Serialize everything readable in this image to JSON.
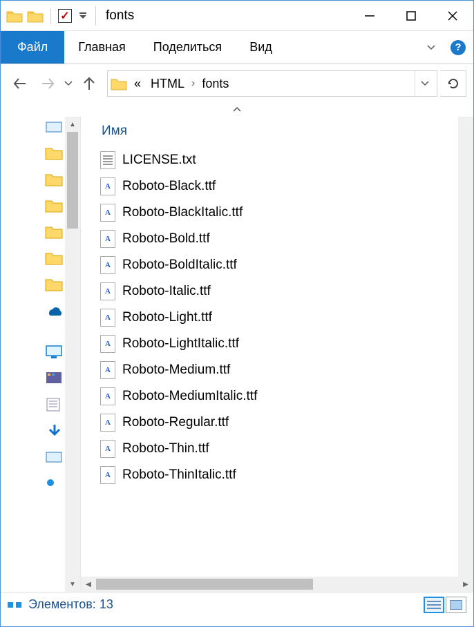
{
  "window": {
    "title": "fonts"
  },
  "ribbon": {
    "file": "Файл",
    "tabs": [
      "Главная",
      "Поделиться",
      "Вид"
    ]
  },
  "breadcrumb": {
    "overflow": "«",
    "parts": [
      "HTML",
      "fonts"
    ]
  },
  "column_header": "Имя",
  "files": [
    {
      "name": "LICENSE.txt",
      "type": "txt"
    },
    {
      "name": "Roboto-Black.ttf",
      "type": "ttf"
    },
    {
      "name": "Roboto-BlackItalic.ttf",
      "type": "ttf"
    },
    {
      "name": "Roboto-Bold.ttf",
      "type": "ttf"
    },
    {
      "name": "Roboto-BoldItalic.ttf",
      "type": "ttf"
    },
    {
      "name": "Roboto-Italic.ttf",
      "type": "ttf"
    },
    {
      "name": "Roboto-Light.ttf",
      "type": "ttf"
    },
    {
      "name": "Roboto-LightItalic.ttf",
      "type": "ttf"
    },
    {
      "name": "Roboto-Medium.ttf",
      "type": "ttf"
    },
    {
      "name": "Roboto-MediumItalic.ttf",
      "type": "ttf"
    },
    {
      "name": "Roboto-Regular.ttf",
      "type": "ttf"
    },
    {
      "name": "Roboto-Thin.ttf",
      "type": "ttf"
    },
    {
      "name": "Roboto-ThinItalic.ttf",
      "type": "ttf"
    }
  ],
  "status": {
    "label": "Элементов:",
    "count": "13"
  }
}
